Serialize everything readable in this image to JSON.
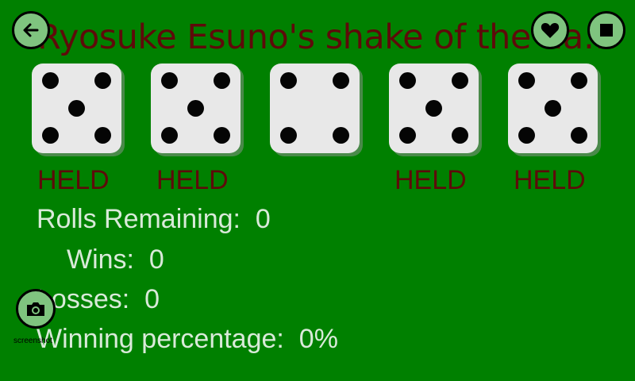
{
  "header": {
    "title": "Ryosuke Esuno's shake of the day...",
    "back_icon": "arrow-left-icon",
    "heart_icon": "heart-icon",
    "stop_icon": "stop-square-icon"
  },
  "dice": [
    {
      "value": 5,
      "held_label": "HELD"
    },
    {
      "value": 5,
      "held_label": "HELD"
    },
    {
      "value": 4,
      "held_label": ""
    },
    {
      "value": 5,
      "held_label": "HELD"
    },
    {
      "value": 5,
      "held_label": "HELD"
    }
  ],
  "stats": {
    "rolls_remaining_label": "Rolls Remaining:",
    "rolls_remaining_value": "0",
    "wins_label": "Wins:",
    "wins_value": "0",
    "losses_label": "Losses:",
    "losses_value": "0",
    "winning_pct_label": "Winning percentage:",
    "winning_pct_value": "0%"
  },
  "screenshot": {
    "label": "screenshot",
    "icon": "camera-icon"
  },
  "colors": {
    "background": "#008000",
    "title_text": "#5e0a0a",
    "held_text": "#5e0a0a",
    "stat_text": "#d9ead9",
    "die_face": "#e8e8e8",
    "button_fill": "#7fc47f"
  }
}
